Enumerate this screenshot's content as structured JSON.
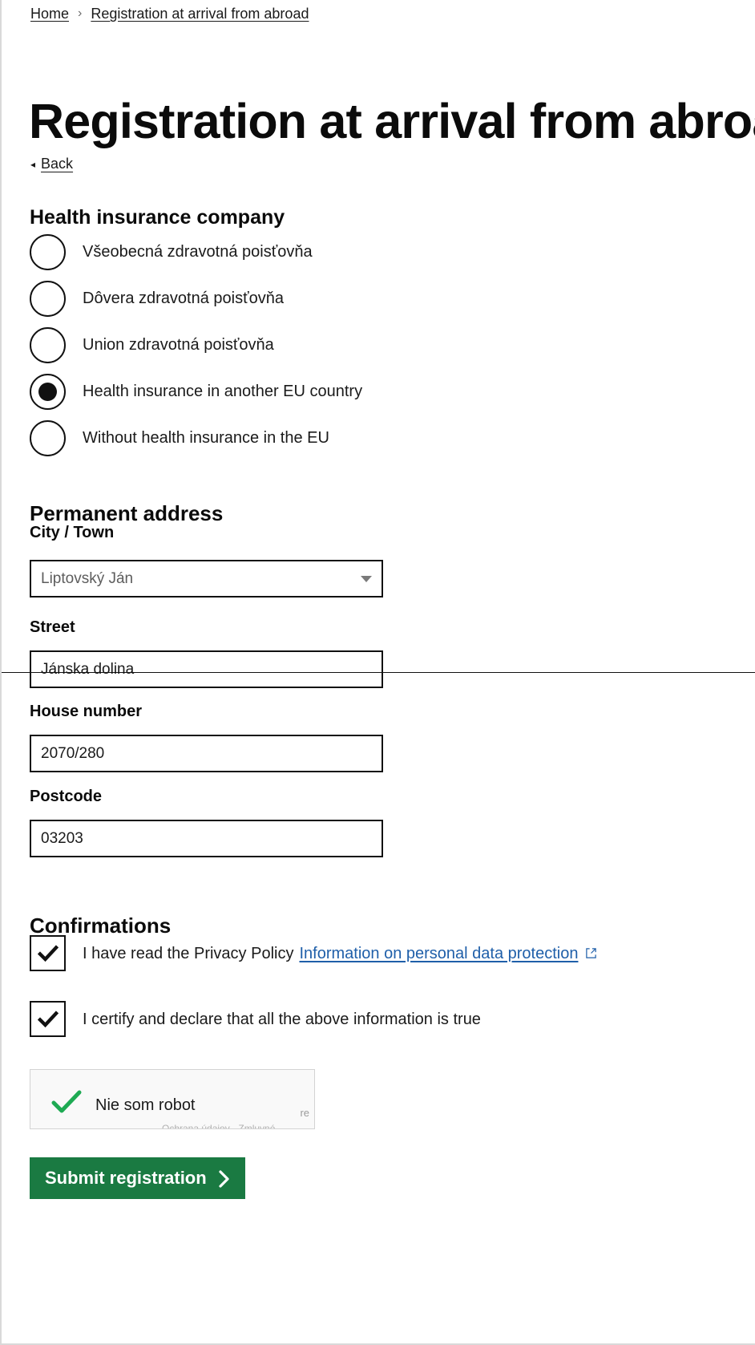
{
  "breadcrumb": {
    "home": "Home",
    "separator": "›",
    "current": "Registration at arrival from abroad"
  },
  "page": {
    "title": "Registration at arrival from abroad"
  },
  "back": {
    "arrow": "◂",
    "label": "Back"
  },
  "insurance": {
    "heading": "Health insurance company",
    "options": [
      {
        "label": "Všeobecná zdravotná poisťovňa",
        "checked": false
      },
      {
        "label": "Dôvera zdravotná poisťovňa",
        "checked": false
      },
      {
        "label": "Union zdravotná poisťovňa",
        "checked": false
      },
      {
        "label": "Health insurance in another EU country",
        "checked": true
      },
      {
        "label": "Without health insurance in the EU",
        "checked": false
      }
    ]
  },
  "address": {
    "heading": "Permanent address",
    "city": {
      "label": "City / Town",
      "value": "Liptovský Ján"
    },
    "street": {
      "label": "Street",
      "value": "Jánska dolina"
    },
    "house_number": {
      "label": "House number",
      "value": "2070/280"
    },
    "postcode": {
      "label": "Postcode",
      "value": "03203"
    }
  },
  "confirmations": {
    "heading": "Confirmations",
    "privacy": {
      "text": "I have read the Privacy Policy",
      "link_label": "Information on personal data protection",
      "checked": true
    },
    "certify": {
      "text": "I certify and declare that all the above information is true",
      "checked": true
    }
  },
  "captcha": {
    "label": "Nie som robot",
    "brand": "re",
    "terms": "Ochrana údajov - Zmluvné",
    "checked": true
  },
  "submit": {
    "label": "Submit registration",
    "chevron": "›"
  },
  "colors": {
    "accent_green": "#1a7a42",
    "link_blue": "#1f5fa9",
    "captcha_green": "#1eaa53"
  }
}
